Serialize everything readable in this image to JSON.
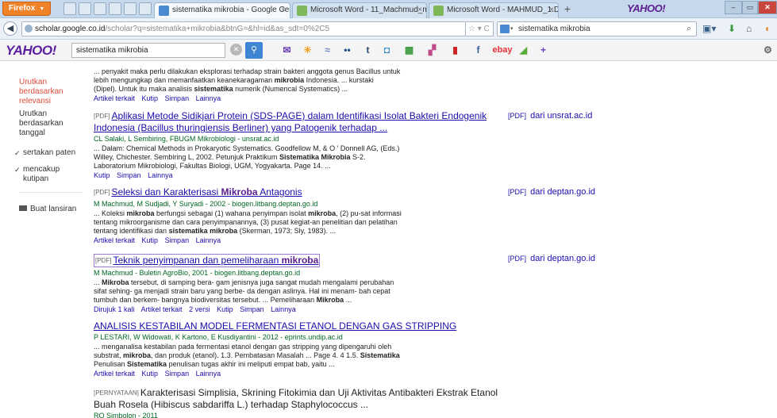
{
  "browser": {
    "firefox_label": "Firefox",
    "tabs": [
      {
        "title": "sistematika mikrobia - Google Cende...",
        "icon_color": "#4a8ad1"
      },
      {
        "title": "Microsoft Word - 11_Machmud_mikr...",
        "icon_color": "#7fb85a"
      },
      {
        "title": "Microsoft Word - MAHMUD_1.DOC - ...",
        "icon_color": "#7fb85a"
      }
    ],
    "new_tab": "+",
    "yahoo_brand": "YAHOO!",
    "url_host": "scholar.google.co.id",
    "url_path": "/scholar?q=sistematika+mikrobia&btnG=&hl=id&as_sdt=0%2C5",
    "search_value": "sistematika mikrobia"
  },
  "yahoo_toolbar": {
    "logo": "YAHOO!",
    "query": "sistematika mikrobia",
    "icons": [
      "mail-icon",
      "weather-icon",
      "news-icon",
      "tumblr-icon",
      "flickr-icon",
      "chart-icon",
      "finance-icon",
      "bookmark-icon",
      "facebook-icon",
      "ebay-icon",
      "games-icon",
      "plus-icon"
    ]
  },
  "sidebar": {
    "sort_relevance": "Urutkan berdasarkan relevansi",
    "sort_date": "Urutkan berdasarkan tanggal",
    "include_patents": "sertakan paten",
    "include_citations": "mencakup kutipan",
    "create_alert": "Buat lansiran"
  },
  "results": [
    {
      "cut_title": "...........",
      "snippet_lines": [
        "... penyakit maka perlu dilakukan eksplorasi terhadap strain bakteri anggota genus Bacillus untuk",
        "lebih mengungkap dan memanfaatkan keanekaragaman mikrobia Indonesia. ... kurstaki",
        "(Dipel). Untuk itu maka analisis sistematika numerik (Numencal Systematics) ..."
      ],
      "links": [
        "Artikel terkait",
        "Kutip",
        "Simpan",
        "Lainnya"
      ]
    },
    {
      "tag": "[PDF]",
      "title_line1": "Aplikasi Metode Sidikjari Protein (SDS-PAGE) dalam Identifikasi Isolat Bakteri Endogenik",
      "title_line2": "Indonesia (Bacillus thuringiensis Berliner) yang Patogenik terhadap ...",
      "meta": "CL Salaki, L Sembiring, FBUGM Mikrobiologi - unsrat.ac.id",
      "snippet_lines": [
        "... Dalam: Chemical Methods in Prokaryotic Systematics. Goodfellow M, & O ' Donnell AG, (Eds.)",
        "Willey, Chichester. Sembiring L, 2002. Petunjuk Praktikum Sistematika Mikrobia S-2.",
        "Laboratorium Mikrobiologi, Fakultas Biologi, UGM, Yogyakarta. Page 14. ..."
      ],
      "links": [
        "Kutip",
        "Simpan",
        "Lainnya"
      ],
      "pdf_tag": "[PDF]",
      "pdf_source": "dari unsrat.ac.id"
    },
    {
      "tag": "[PDF]",
      "title_pre": "Seleksi dan Karakterisasi ",
      "title_bold": "Mikroba",
      "title_post": " Antagonis",
      "meta": "M Machmud, M Sudjadi, Y Suryadi - 2002 - biogen.litbang.deptan.go.id",
      "snippet_lines": [
        "... Koleksi mikroba berfungsi sebagai (1) wahana penyimpan isolat mikroba, (2) pu-sat informasi",
        "tentang mikroorganisme dan cara penyimpanannya, (3) pusat kegiat-an penelitian dan pelatihan",
        "tentang identifikasi dan sistematika mikroba (Skerman, 1973; Sly, 1983). ..."
      ],
      "links": [
        "Artikel terkait",
        "Kutip",
        "Simpan",
        "Lainnya"
      ],
      "pdf_tag": "[PDF]",
      "pdf_source": "dari deptan.go.id"
    },
    {
      "tag": "[PDF]",
      "title_pre": "Teknik penyimpanan dan pemeliharaan ",
      "title_bold": "mikroba",
      "meta": "M Machmud - Buletin AgroBio, 2001 - biogen.litbang.deptan.go.id",
      "snippet_lines": [
        "... Mikroba tersebut, di samping bera- gam jenisnya juga sangat mudah mengalami perubahan",
        "sifat sehing- ga menjadi strain baru yang berbe- da dengan aslinya. Hal ini menam- bah cepat",
        "tumbuh dan berkem- bangnya biodiversitas tersebut. ... Pemeliharaan Mikroba ..."
      ],
      "links": [
        "Dirujuk 1 kali",
        "Artikel terkait",
        "2 versi",
        "Kutip",
        "Simpan",
        "Lainnya"
      ],
      "pdf_tag": "[PDF]",
      "pdf_source": "dari deptan.go.id"
    },
    {
      "title": "ANALISIS KESTABILAN MODEL FERMENTASI ETANOL DENGAN GAS STRIPPING",
      "meta": "P LESTARI, W Widowati, K Kartono, E Kusdiyantini - 2012 - eprints.undip.ac.id",
      "snippet_lines": [
        "... menganalisa kestabilan pada fermentasi etanol dengan gas stripping yang dipengaruhi oleh",
        "substrat, mikroba, dan produk (etanol). 1.3. Pembatasan Masalah ... Page 4. 4 1.5. Sistematika",
        "Penulisan Sistematika penulisan tugas akhir ini meliputi empat bab, yaitu ..."
      ],
      "links": [
        "Artikel terkait",
        "Kutip",
        "Simpan",
        "Lainnya"
      ]
    },
    {
      "tag": "[PERNYATAAN]",
      "title_line1": "Karakterisasi Simplisia, Skrining Fitokimia dan Uji Aktivitas Antibakteri Ekstrak Etanol",
      "title_line2": "Buah Rosela (Hibiscus sabdariffa L.) terhadap Staphylococcus ...",
      "meta": "RO Simbolon - 2011"
    }
  ]
}
